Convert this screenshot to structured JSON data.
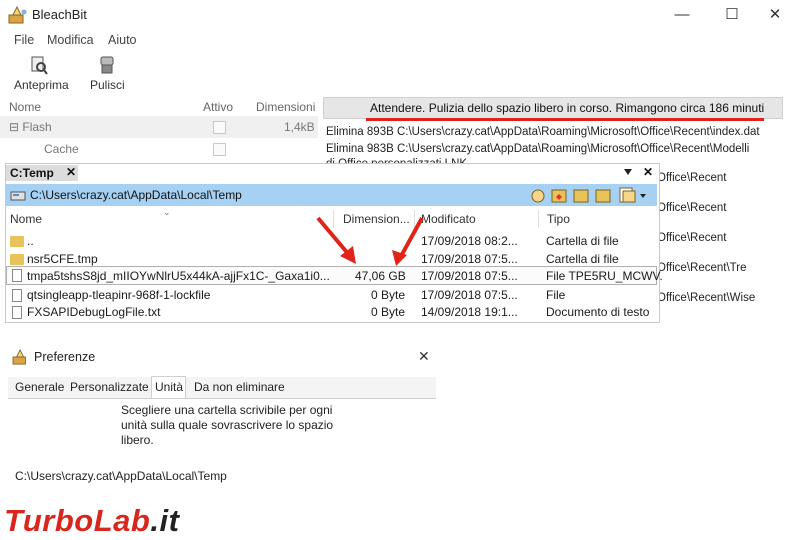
{
  "window": {
    "title": "BleachBit",
    "minimize_glyph": "—",
    "maximize_glyph": "☐",
    "close_glyph": "✕"
  },
  "menu": {
    "items": [
      "File",
      "Modifica",
      "Aiuto"
    ]
  },
  "toolbar": {
    "preview_label": "Anteprima",
    "clean_label": "Pulisci"
  },
  "tree": {
    "headers": {
      "name": "Nome",
      "active": "Attivo",
      "size": "Dimensioni"
    },
    "rows": [
      {
        "label": "⊟  Flash",
        "size": "1,4kB"
      },
      {
        "label": "Cache",
        "size": ""
      }
    ]
  },
  "status": {
    "text": "Attendere. Pulizia dello spazio libero in corso. Rimangono circa 186 minuti",
    "log": [
      "Elimina 893B C:\\Users\\crazy.cat\\AppData\\Roaming\\Microsoft\\Office\\Recent\\index.dat",
      "Elimina 983B C:\\Users\\crazy.cat\\AppData\\Roaming\\Microsoft\\Office\\Recent\\Modelli",
      "di Office personalizzati.LNK"
    ],
    "log_right": [
      "Office\\Recent",
      "Office\\Recent",
      "Office\\Recent",
      "Office\\Recent\\Tre",
      "Office\\Recent\\Wise"
    ]
  },
  "file_dialog": {
    "tab_label": "C:Temp",
    "tab_close": "✕",
    "path": "C:\\Users\\crazy.cat\\AppData\\Local\\Temp",
    "headers": {
      "name": "Nome",
      "size": "Dimension...",
      "modified": "Modificato",
      "type": "Tipo"
    },
    "rows": [
      {
        "name": "..",
        "size": "",
        "modified": "17/09/2018 08:2...",
        "type": "Cartella di file",
        "icon": "folder-icon"
      },
      {
        "name": "nsr5CFE.tmp",
        "size": "",
        "modified": "17/09/2018 07:5...",
        "type": "Cartella di file",
        "icon": "folder-icon"
      },
      {
        "name": "tmpa5tshsS8jd_mIIOYwNlrU5x44kA-ajjFx1C-_Gaxa1i0...",
        "size": "47,06 GB",
        "modified": "17/09/2018 07:5...",
        "type": "File TPE5RU_MCWV.",
        "icon": "file-icon"
      },
      {
        "name": "qtsingleapp-tleapinr-968f-1-lockfile",
        "size": "0 Byte",
        "modified": "17/09/2018 07:5...",
        "type": "File",
        "icon": "file-icon"
      },
      {
        "name": "FXSAPIDebugLogFile.txt",
        "size": "0 Byte",
        "modified": "14/09/2018 19:1...",
        "type": "Documento di testo",
        "icon": "file-icon"
      }
    ]
  },
  "preferences": {
    "title": "Preferenze",
    "close_glyph": "✕",
    "tabs": [
      "Generale",
      "Personalizzate",
      "Unità",
      "Da non eliminare"
    ],
    "active_tab": "Unità",
    "description": [
      "Scegliere una cartella scrivibile per ogni",
      "unità sulla quale sovrascrivere lo spazio",
      "libero."
    ],
    "path": "C:\\Users\\crazy.cat\\AppData\\Local\\Temp"
  },
  "watermark": {
    "part1": "TurboLab",
    "part2": ".it"
  },
  "colors": {
    "accent_red": "#e2231a",
    "path_bar": "#a6d1f3",
    "folder": "#e8c35a"
  }
}
